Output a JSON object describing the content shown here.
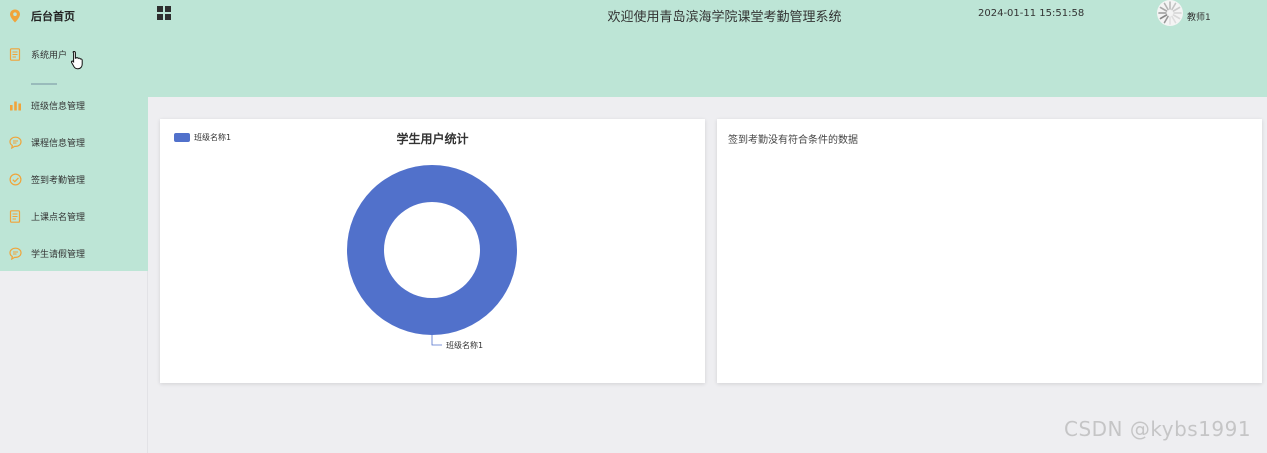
{
  "sidebar": {
    "home": {
      "label": "后台首页",
      "icon": "location-pin-icon"
    },
    "items": [
      {
        "label": "系统用户",
        "icon": "document-icon"
      },
      {
        "label": "班级信息管理",
        "icon": "bar-chart-icon"
      },
      {
        "label": "课程信息管理",
        "icon": "chat-bubble-icon"
      },
      {
        "label": "签到考勤管理",
        "icon": "check-circle-icon"
      },
      {
        "label": "上课点名管理",
        "icon": "document-icon"
      },
      {
        "label": "学生请假管理",
        "icon": "chat-bubble-icon"
      }
    ],
    "accent_color": "#f0a43a",
    "bg_color": "#bde5d6"
  },
  "header": {
    "title": "欢迎使用青岛滨海学院课堂考勤管理系统",
    "datetime": "2024-01-11 15:51:58",
    "user_name": "教师1",
    "menu_icon": "grid-menu-icon"
  },
  "chart_card": {
    "title": "学生用户统计",
    "legend_label": "班级名称1"
  },
  "chart_data": {
    "type": "pie",
    "title": "学生用户统计",
    "donut": true,
    "categories": [
      "班级名称1"
    ],
    "values": [
      1
    ],
    "colors": [
      "#5171cb"
    ],
    "legend_position": "top-left"
  },
  "attendance_card": {
    "message": "签到考勤没有符合条件的数据"
  },
  "watermark": "CSDN @kybs1991"
}
